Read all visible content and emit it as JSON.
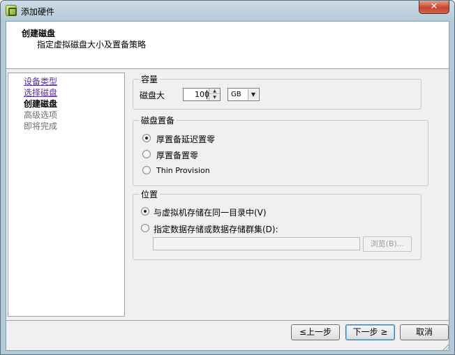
{
  "window": {
    "title": "添加硬件",
    "close_label": "✕"
  },
  "header": {
    "title": "创建磁盘",
    "subtitle": "指定虚拟磁盘大小及置备策略"
  },
  "steps": [
    {
      "label": "设备类型",
      "state": "link"
    },
    {
      "label": "选择磁盘",
      "state": "link"
    },
    {
      "label": "创建磁盘",
      "state": "current"
    },
    {
      "label": "高级选项",
      "state": "future"
    },
    {
      "label": "即将完成",
      "state": "future"
    }
  ],
  "capacity": {
    "group_title": "容量",
    "size_label": "磁盘大",
    "size_value": "100",
    "unit_value": "GB"
  },
  "provisioning": {
    "group_title": "磁盘置备",
    "options": [
      {
        "label": "厚置备延迟置零",
        "checked": true
      },
      {
        "label": "厚置备置零",
        "checked": false
      },
      {
        "label": "Thin Provision",
        "checked": false
      }
    ]
  },
  "location": {
    "group_title": "位置",
    "options": [
      {
        "label": "与虚拟机存储在同一目录中(V)",
        "checked": true
      },
      {
        "label": "指定数据存储或数据存储群集(D):",
        "checked": false
      }
    ],
    "datastore_value": "",
    "browse_label": "浏览(B)..."
  },
  "footer": {
    "back_label": "≤上一步",
    "next_label": "下一步 ≥",
    "cancel_label": "取消"
  },
  "colors": {
    "link": "#5b2fa8",
    "titlebar": "#b5cad7",
    "close": "#c7452d"
  }
}
